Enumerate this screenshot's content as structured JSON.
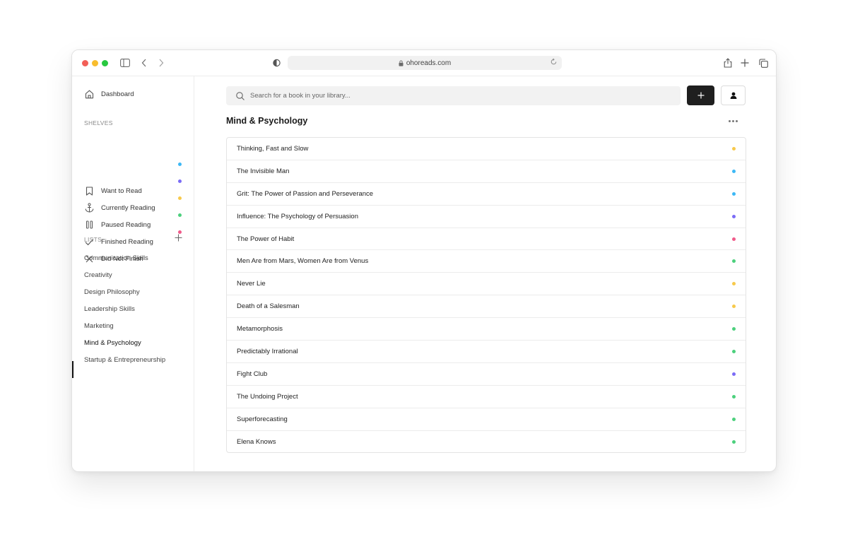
{
  "browser": {
    "url": "ohoreads.com"
  },
  "sidebar": {
    "dashboard_label": "Dashboard",
    "shelves_label": "SHELVES",
    "shelves": [
      {
        "label": "Want to Read",
        "icon": "bookmark-icon",
        "color": "#3db8f5"
      },
      {
        "label": "Currently Reading",
        "icon": "anchor-icon",
        "color": "#7b6cf6"
      },
      {
        "label": "Paused Reading",
        "icon": "pause-icon",
        "color": "#f7c94b"
      },
      {
        "label": "Finished Reading",
        "icon": "check-icon",
        "color": "#4cd07d"
      },
      {
        "label": "Did Not Finish",
        "icon": "x-icon",
        "color": "#f05b8a"
      }
    ],
    "lists_label": "LISTS",
    "lists": [
      "Communication Skills",
      "Creativity",
      "Design Philosophy",
      "Leadership Skills",
      "Marketing",
      "Mind & Psychology",
      "Startup & Entrepreneurship"
    ],
    "active_list": "Mind & Psychology"
  },
  "search": {
    "placeholder": "Search for a book in your library..."
  },
  "main": {
    "title": "Mind & Psychology",
    "books": [
      {
        "title": "Thinking, Fast and Slow",
        "color": "#f7c94b"
      },
      {
        "title": "The Invisible Man",
        "color": "#3db8f5"
      },
      {
        "title": "Grit: The Power of Passion and Perseverance",
        "color": "#3db8f5"
      },
      {
        "title": "Influence: The Psychology of Persuasion",
        "color": "#7b6cf6"
      },
      {
        "title": "The Power of Habit",
        "color": "#f05b8a"
      },
      {
        "title": "Men Are from Mars, Women Are from Venus",
        "color": "#4cd07d"
      },
      {
        "title": "Never Lie",
        "color": "#f7c94b"
      },
      {
        "title": "Death of a Salesman",
        "color": "#f7c94b"
      },
      {
        "title": "Metamorphosis",
        "color": "#4cd07d"
      },
      {
        "title": "Predictably Irrational",
        "color": "#4cd07d"
      },
      {
        "title": "Fight Club",
        "color": "#7b6cf6"
      },
      {
        "title": "The Undoing Project",
        "color": "#4cd07d"
      },
      {
        "title": "Superforecasting",
        "color": "#4cd07d"
      },
      {
        "title": "Elena Knows",
        "color": "#4cd07d"
      }
    ]
  }
}
